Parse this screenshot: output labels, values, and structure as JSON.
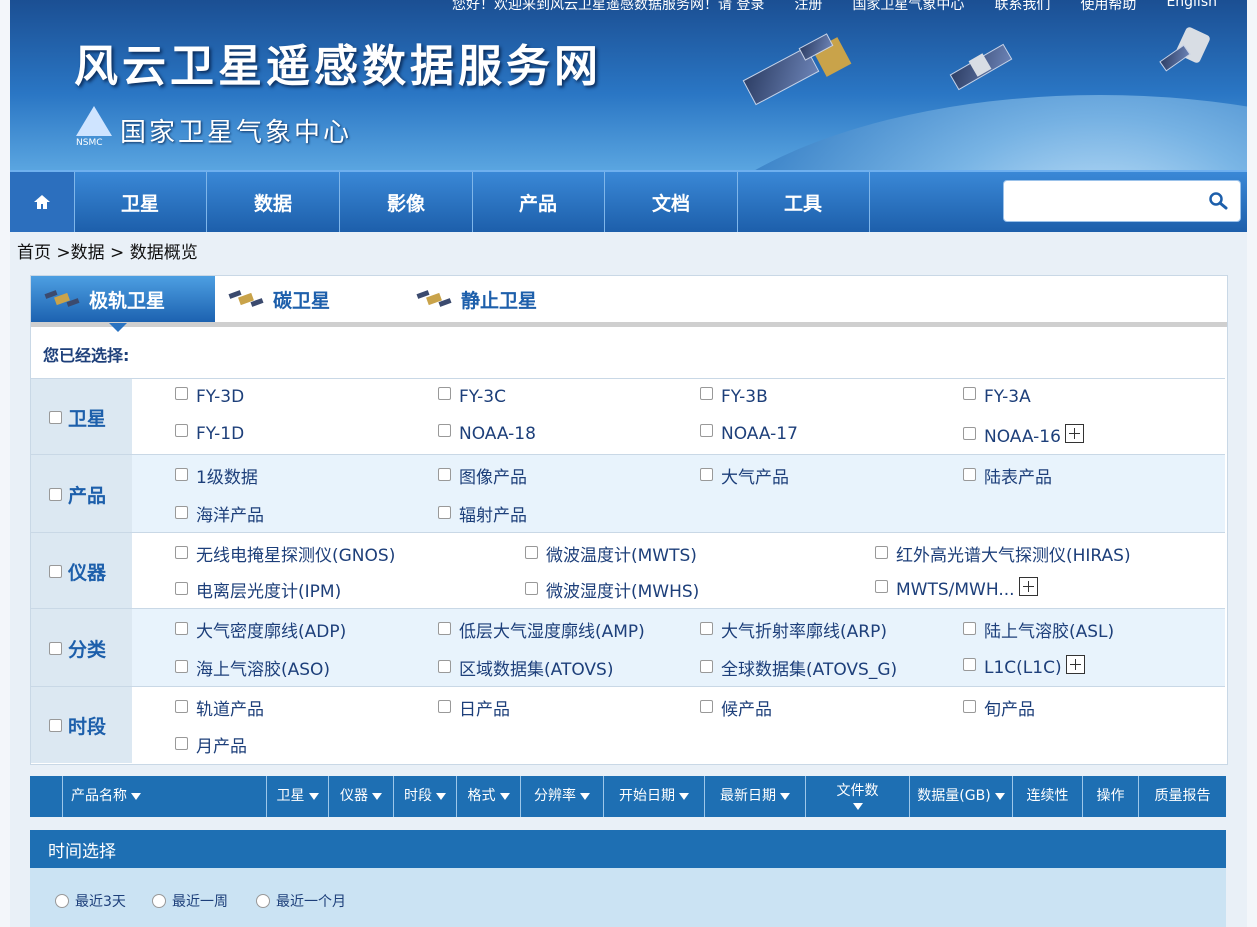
{
  "top_links": [
    "您好！欢迎来到风云卫星遥感数据服务网！请 登录",
    "注册",
    "国家卫星气象中心",
    "联系我们",
    "使用帮助",
    "English"
  ],
  "site_title": "风云卫星遥感数据服务网",
  "org_name": "国家卫星气象中心",
  "org_abbr": "NSMC",
  "nav": {
    "items": [
      "卫星",
      "数据",
      "影像",
      "产品",
      "文档",
      "工具"
    ],
    "search_placeholder": ""
  },
  "breadcrumb": "首页 >数据 > 数据概览",
  "tabs": [
    "极轨卫星",
    "碳卫星",
    "静止卫星"
  ],
  "selected_label": "您已经选择:",
  "filters": [
    {
      "label": "卫星",
      "options": [
        "FY-3D",
        "FY-3C",
        "FY-3B",
        "FY-3A",
        "FY-1D",
        "NOAA-18",
        "NOAA-17",
        "NOAA-16"
      ]
    },
    {
      "label": "产品",
      "options": [
        "1级数据",
        "图像产品",
        "大气产品",
        "陆表产品",
        "海洋产品",
        "辐射产品"
      ]
    },
    {
      "label": "仪器",
      "options": [
        "无线电掩星探测仪(GNOS)",
        "微波温度计(MWTS)",
        "红外高光谱大气探测仪(HIRAS)",
        "电离层光度计(IPM)",
        "微波湿度计(MWHS)",
        "MWTS/MWH..."
      ]
    },
    {
      "label": "分类",
      "options": [
        "大气密度廓线(ADP)",
        "低层大气湿度廓线(AMP)",
        "大气折射率廓线(ARP)",
        "陆上气溶胶(ASL)",
        "海上气溶胶(ASO)",
        "区域数据集(ATOVS)",
        "全球数据集(ATOVS_G)",
        "L1C(L1C)"
      ]
    },
    {
      "label": "时段",
      "options": [
        "轨道产品",
        "日产品",
        "候产品",
        "旬产品",
        "月产品"
      ]
    }
  ],
  "table_headers": [
    "产品名称",
    "卫星",
    "仪器",
    "时段",
    "格式",
    "分辨率",
    "开始日期",
    "最新日期",
    "文件数",
    "数据量(GB)",
    "连续性",
    "操作",
    "质量报告"
  ],
  "time_select": {
    "title": "时间选择",
    "options": [
      "最近3天",
      "最近一周",
      "最近一个月"
    ]
  }
}
